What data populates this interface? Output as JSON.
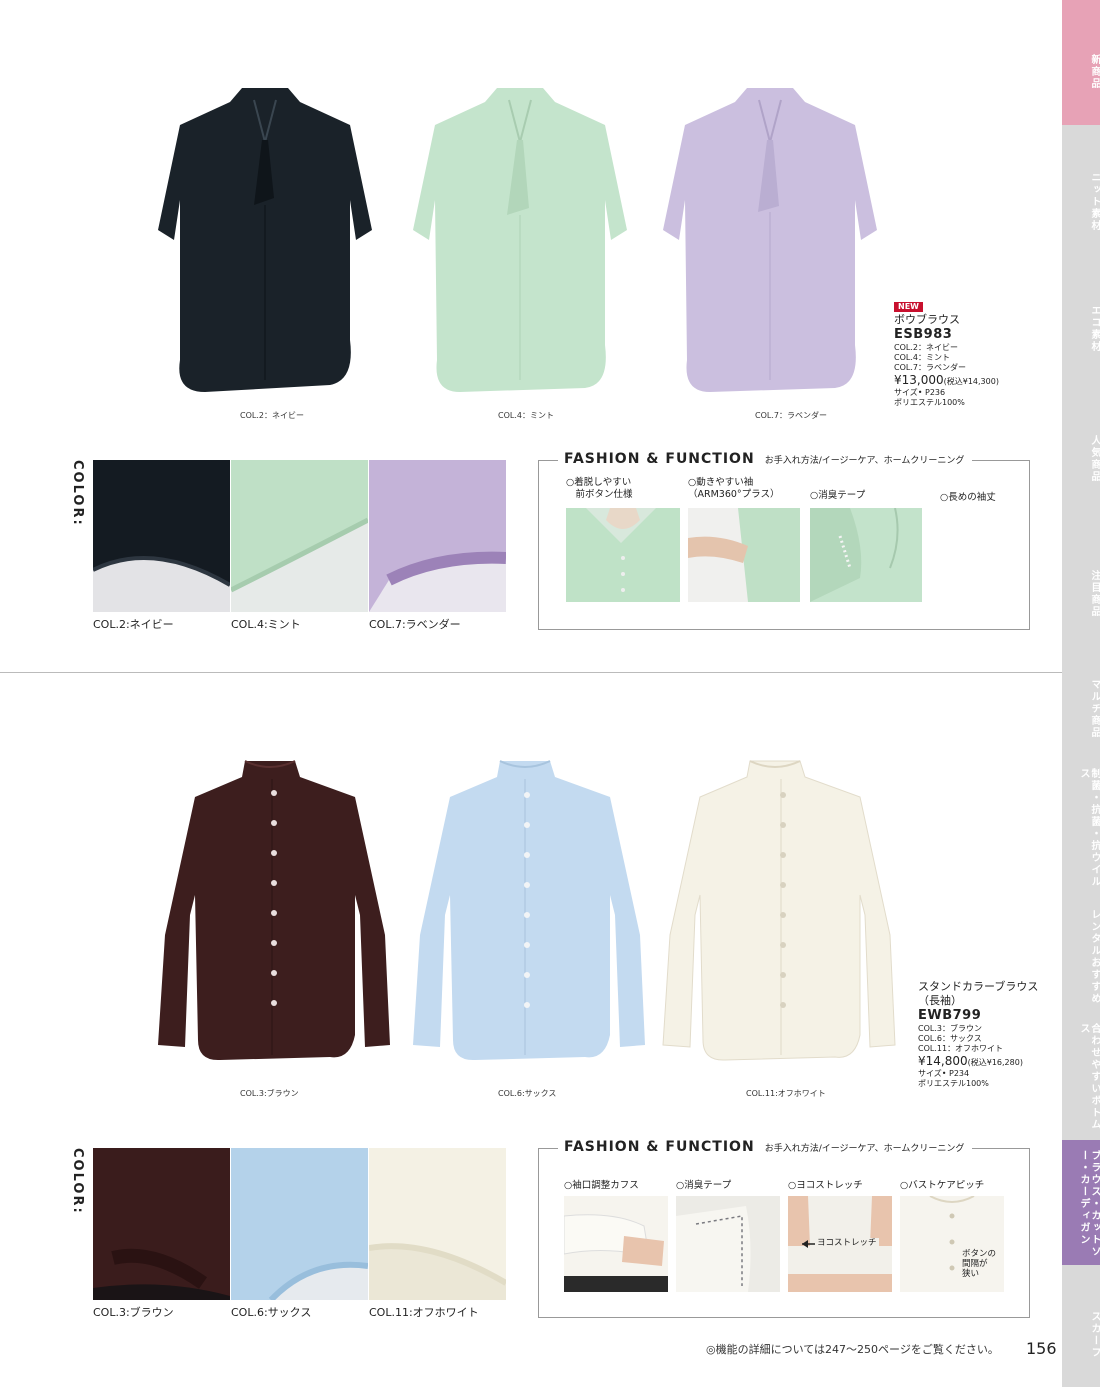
{
  "sidebar": {
    "tabs": [
      {
        "label": "新商品",
        "state": "highlight"
      },
      {
        "label": "ニット素材",
        "state": "normal"
      },
      {
        "label": "エコ素材",
        "state": "normal"
      },
      {
        "label": "人気商品",
        "state": "normal"
      },
      {
        "label": "注目商品",
        "state": "normal"
      },
      {
        "label": "マルチ商品",
        "state": "normal"
      },
      {
        "label": "制菌・抗菌・抗ウイルス",
        "state": "normal"
      },
      {
        "label": "レンタルおすすめ",
        "state": "normal"
      },
      {
        "label": "合わせやすいボトムス",
        "state": "normal"
      },
      {
        "label": "ブラウス・カットソー・カーディガン",
        "state": "current"
      },
      {
        "label": "スカーフ",
        "state": "normal"
      }
    ],
    "colors": {
      "highlight": "#e7a2b6",
      "current": "#9a7bb4",
      "normal": "#d9d9d9"
    }
  },
  "product1": {
    "badge": "NEW",
    "name": "ボウブラウス",
    "code": "ESB983",
    "colors_list": [
      "COL.2：ネイビー",
      "COL.4：ミント",
      "COL.7：ラベンダー"
    ],
    "price": "¥13,000",
    "price_tax": "(税込¥14,300)",
    "size": "サイズ• P236",
    "material": "ポリエステル100%",
    "photo_captions": [
      "COL.2：ネイビー",
      "COL.4：ミント",
      "COL.7：ラベンダー"
    ],
    "color_title": "COLOR:",
    "swatch_captions": [
      "COL.2:ネイビー",
      "COL.4:ミント",
      "COL.7:ラベンダー"
    ],
    "swatch_colors": [
      "#141b22",
      "#bfe0c6",
      "#c4b3d8"
    ],
    "garment_colors": [
      "#1a2229",
      "#c4e4cc",
      "#cbbfdf"
    ],
    "ff_title": "FASHION & FUNCTION",
    "ff_sub": "お手入れ方法/イージーケア、ホームクリーニング",
    "features": [
      "○着脱しやすい\n　前ボタン仕様",
      "○動きやすい袖\n（ARM360°プラス）",
      "○消臭テープ",
      "○長めの袖丈"
    ]
  },
  "product2": {
    "name": "スタンドカラーブラウス",
    "name2": "（長袖）",
    "code": "EWB799",
    "colors_list": [
      "COL.3：ブラウン",
      "COL.6：サックス",
      "COL.11：オフホワイト"
    ],
    "price": "¥14,800",
    "price_tax": "(税込¥16,280)",
    "size": "サイズ• P234",
    "material": "ポリエステル100%",
    "photo_captions": [
      "COL.3:ブラウン",
      "COL.6:サックス",
      "COL.11:オフホワイト"
    ],
    "color_title": "COLOR:",
    "swatch_captions": [
      "COL.3:ブラウン",
      "COL.6:サックス",
      "COL.11:オフホワイト"
    ],
    "swatch_colors": [
      "#3a1c1c",
      "#b4d2ea",
      "#f4f1e4"
    ],
    "garment_colors": [
      "#3d1e1e",
      "#c3daf0",
      "#f5f2e6"
    ],
    "ff_title": "FASHION & FUNCTION",
    "ff_sub": "お手入れ方法/イージーケア、ホームクリーニング",
    "features": [
      "○袖口調整カフス",
      "○消臭テープ",
      "○ヨコストレッチ",
      "○バストケアピッチ"
    ],
    "stretch_label": "ヨコストレッチ",
    "button_note": "ボタンの\n間隔が\n狭い"
  },
  "footer": {
    "note": "◎機能の詳細については247〜250ページをご覧ください。",
    "page": "156"
  }
}
